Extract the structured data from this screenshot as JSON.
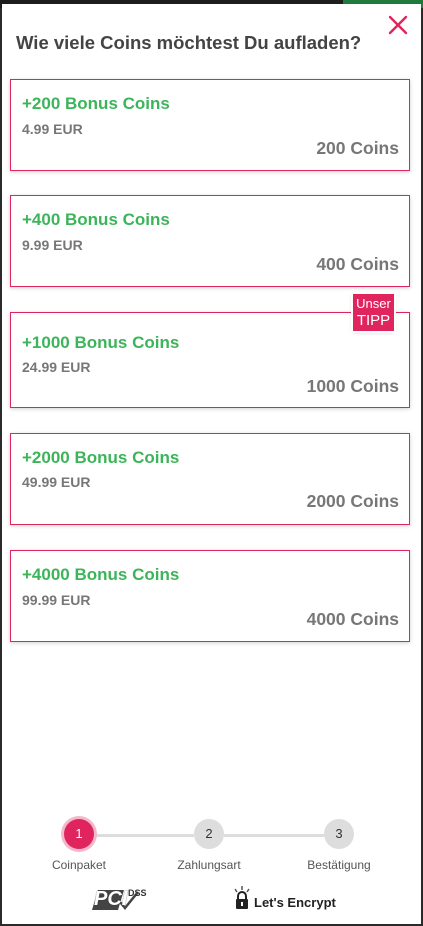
{
  "title": "Wie viele Coins möchtest Du aufladen?",
  "close_icon": "close-icon",
  "packages": [
    {
      "bonus": "+200 Bonus Coins",
      "price": "4.99 EUR",
      "coins": "200 Coins"
    },
    {
      "bonus": "+400 Bonus Coins",
      "price": "9.99 EUR",
      "coins": "400 Coins"
    },
    {
      "bonus": "+1000 Bonus Coins",
      "price": "24.99 EUR",
      "coins": "1000 Coins"
    },
    {
      "bonus": "+2000 Bonus Coins",
      "price": "49.99 EUR",
      "coins": "2000 Coins"
    },
    {
      "bonus": "+4000 Bonus Coins",
      "price": "99.99 EUR",
      "coins": "4000 Coins"
    }
  ],
  "tip_badge": {
    "line1": "Unser",
    "line2": "TIPP"
  },
  "steps": [
    {
      "number": "1",
      "label": "Coinpaket",
      "active": true
    },
    {
      "number": "2",
      "label": "Zahlungsart",
      "active": false
    },
    {
      "number": "3",
      "label": "Bestätigung",
      "active": false
    }
  ],
  "trust_badges": {
    "pci": "PCI",
    "pci_dss": "DSS",
    "lets_encrypt": "Let's Encrypt"
  },
  "colors": {
    "accent": "#e0245e",
    "bonus_green": "#3cb55a",
    "muted_text": "#777777"
  }
}
